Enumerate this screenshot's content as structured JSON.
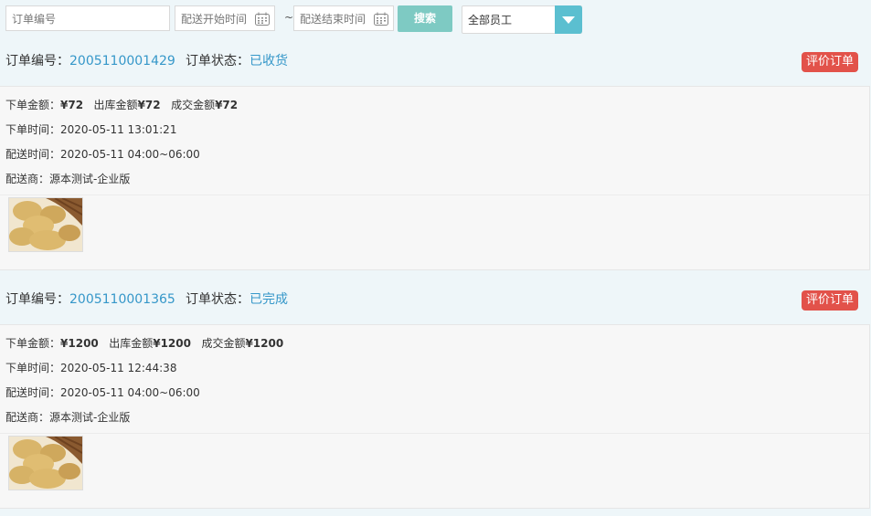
{
  "filters": {
    "order_no_placeholder": "订单编号",
    "start_placeholder": "配送开始时间",
    "end_placeholder": "配送结束时间",
    "separator": "~",
    "search_label": "搜索",
    "staff_selected": "全部员工"
  },
  "orders": [
    {
      "no_label": "订单编号：",
      "no": "2005110001429",
      "status_label": "订单状态：",
      "status": "已收货",
      "rate_label": "评价订单",
      "amount_label": "下单金额：",
      "amount": "¥72",
      "out_label": "出库金额",
      "out_amount": "¥72",
      "deal_label": "成交金额",
      "deal_amount": "¥72",
      "order_time": "下单时间：2020-05-11 13:01:21",
      "delivery_time": "配送时间：2020-05-11 04:00~06:00",
      "supplier": "配送商：源本测试-企业版"
    },
    {
      "no_label": "订单编号：",
      "no": "2005110001365",
      "status_label": "订单状态：",
      "status": "已完成",
      "rate_label": "评价订单",
      "amount_label": "下单金额：",
      "amount": "¥1200",
      "out_label": "出库金额",
      "out_amount": "¥1200",
      "deal_label": "成交金额",
      "deal_amount": "¥1200",
      "order_time": "下单时间：2020-05-11 12:44:38",
      "delivery_time": "配送时间：2020-05-11 04:00~06:00",
      "supplier": "配送商：源本测试-企业版"
    }
  ],
  "icons": {
    "calendar": "calendar-icon",
    "dropdown": "chevron-down-icon",
    "product": "potato-product-image"
  },
  "colors": {
    "accent": "#3597c9",
    "search": "#7ecac3",
    "rate": "#e2524a",
    "select": "#5bbfd0"
  }
}
